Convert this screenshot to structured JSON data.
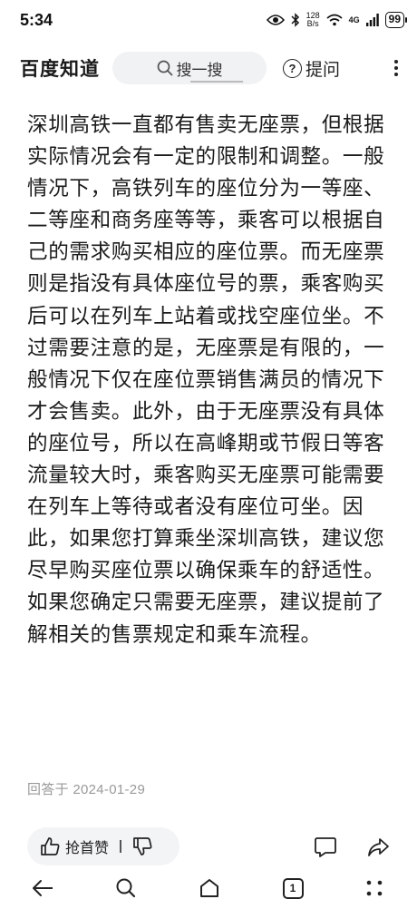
{
  "status_bar": {
    "time": "5:34",
    "speed_value": "128",
    "speed_unit": "B/s",
    "network": "4G",
    "battery": "99"
  },
  "header": {
    "brand": "百度知道",
    "search_placeholder": "搜一搜",
    "ask_label": "提问"
  },
  "answer": {
    "text": "深圳高铁一直都有售卖无座票，但根据实际情况会有一定的限制和调整。一般情况下，高铁列车的座位分为一等座、二等座和商务座等等，乘客可以根据自己的需求购买相应的座位票。而无座票则是指没有具体座位号的票，乘客购买后可以在列车上站着或找空座位坐。不过需要注意的是，无座票是有限的，一般情况下仅在座位票销售满员的情况下才会售卖。此外，由于无座票没有具体的座位号，所以在高峰期或节假日等客流量较大时，乘客购买无座票可能需要在列车上等待或者没有座位可坐。因此，如果您打算乘坐深圳高铁，建议您尽早购买座位票以确保乘车的舒适性。如果您确定只需要无座票，建议提前了解相关的售票规定和乘车流程。",
    "answered_at": "回答于 2024-01-29"
  },
  "actions": {
    "upvote_label": "抢首赞"
  },
  "nav": {
    "tab_count": "1"
  },
  "colors": {
    "text": "#1b1b1b",
    "muted": "#999999",
    "pill_bg": "#f3f4f6"
  }
}
